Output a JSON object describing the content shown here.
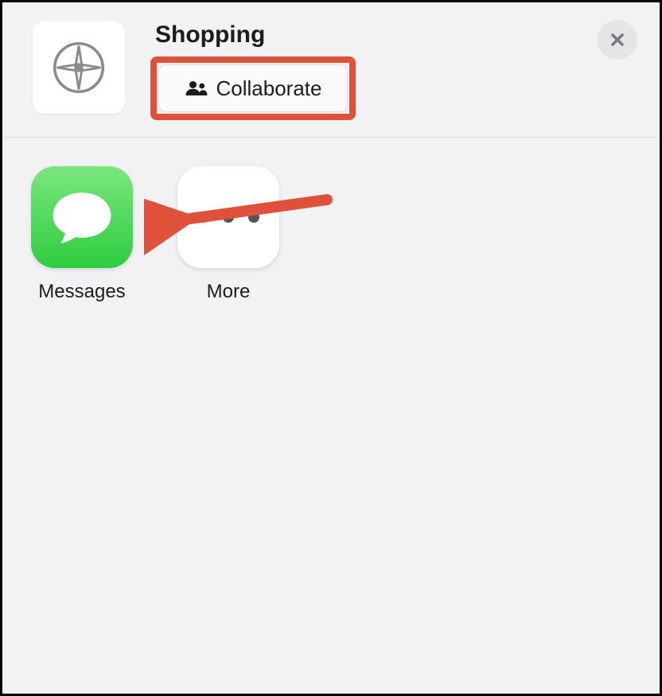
{
  "header": {
    "title": "Shopping",
    "collaborate_label": "Collaborate"
  },
  "apps": {
    "messages_label": "Messages",
    "more_label": "More"
  },
  "colors": {
    "annotation": "#e0513b",
    "messages_gradient_top": "#7be67e",
    "messages_gradient_bottom": "#2ecc40"
  }
}
